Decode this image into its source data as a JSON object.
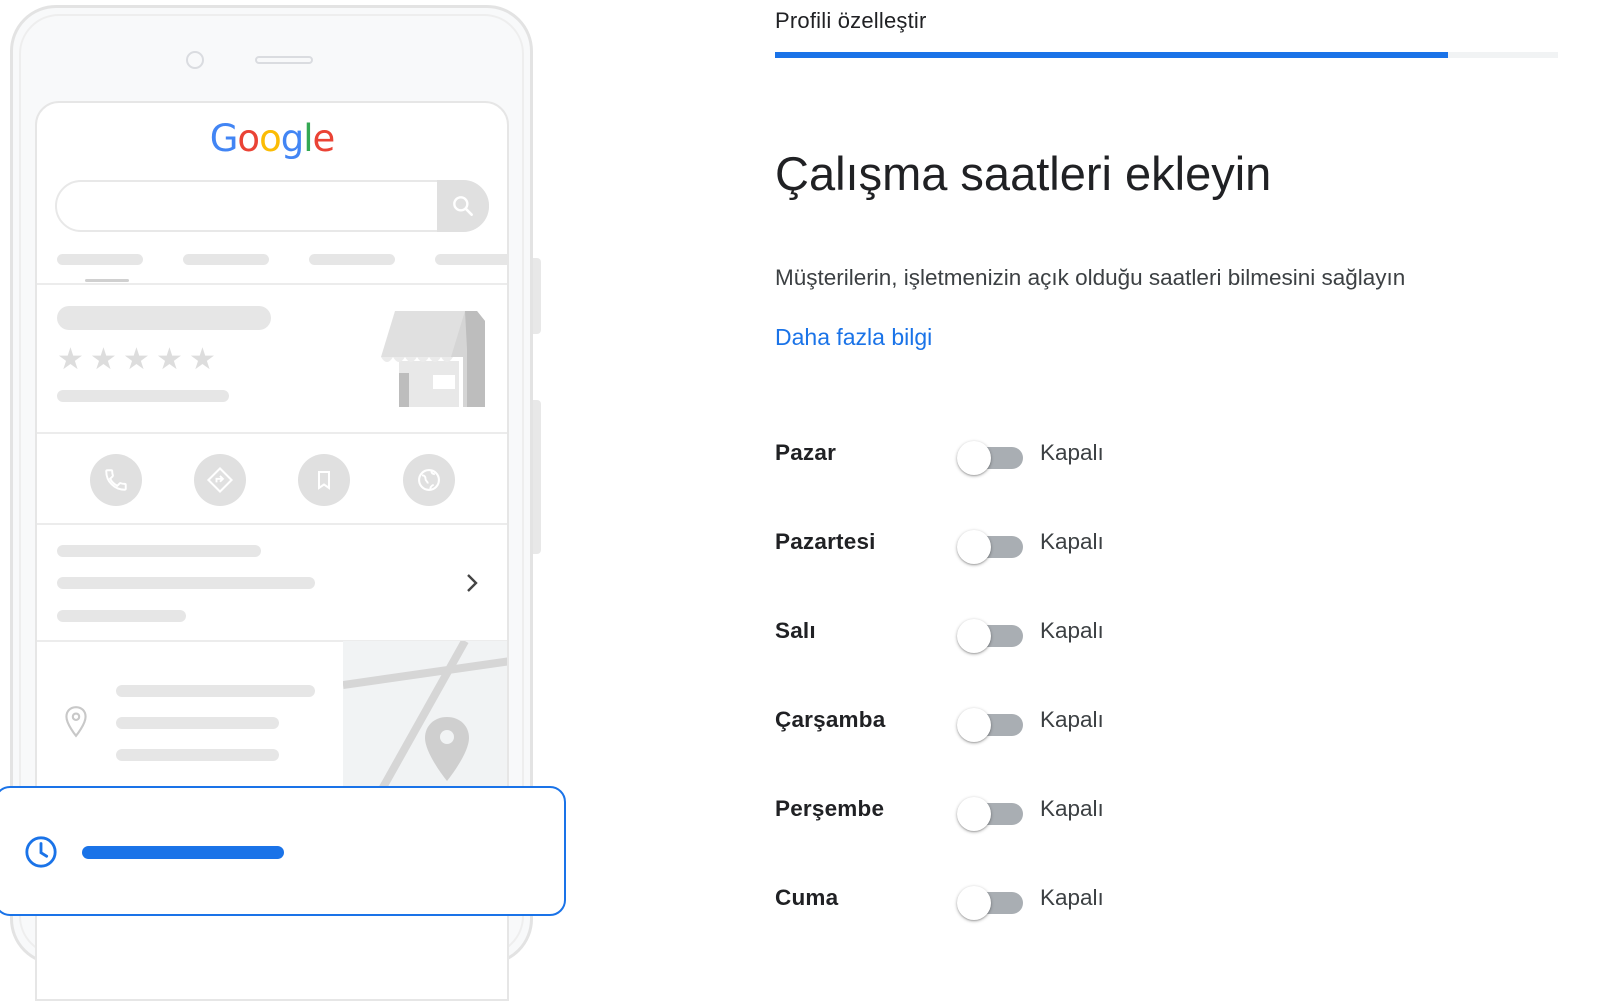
{
  "progress": {
    "section_title": "Profili özelleştir",
    "fraction": 0.86
  },
  "main": {
    "heading": "Çalışma saatleri ekleyin",
    "subtext": "Müşterilerin, işletmenizin açık olduğu saatleri bilmesini sağlayın",
    "learn_more": "Daha fazla bilgi"
  },
  "days": [
    {
      "name": "Pazar",
      "state": "Kapalı",
      "on": false
    },
    {
      "name": "Pazartesi",
      "state": "Kapalı",
      "on": false
    },
    {
      "name": "Salı",
      "state": "Kapalı",
      "on": false
    },
    {
      "name": "Çarşamba",
      "state": "Kapalı",
      "on": false
    },
    {
      "name": "Perşembe",
      "state": "Kapalı",
      "on": false
    },
    {
      "name": "Cuma",
      "state": "Kapalı",
      "on": false
    }
  ],
  "illustration": {
    "logo": {
      "letters": [
        "G",
        "o",
        "o",
        "g",
        "l",
        "e"
      ],
      "colors": [
        "#4285F4",
        "#EA4335",
        "#FBBC05",
        "#4285F4",
        "#34A853",
        "#EA4335"
      ]
    },
    "stars": 5,
    "action_icons": [
      "phone-icon",
      "directions-icon",
      "bookmark-icon",
      "globe-icon"
    ]
  },
  "colors": {
    "accent": "#1a73e8",
    "toggle_off": "#9aa0a6",
    "placeholder": "#e6e6e6"
  }
}
